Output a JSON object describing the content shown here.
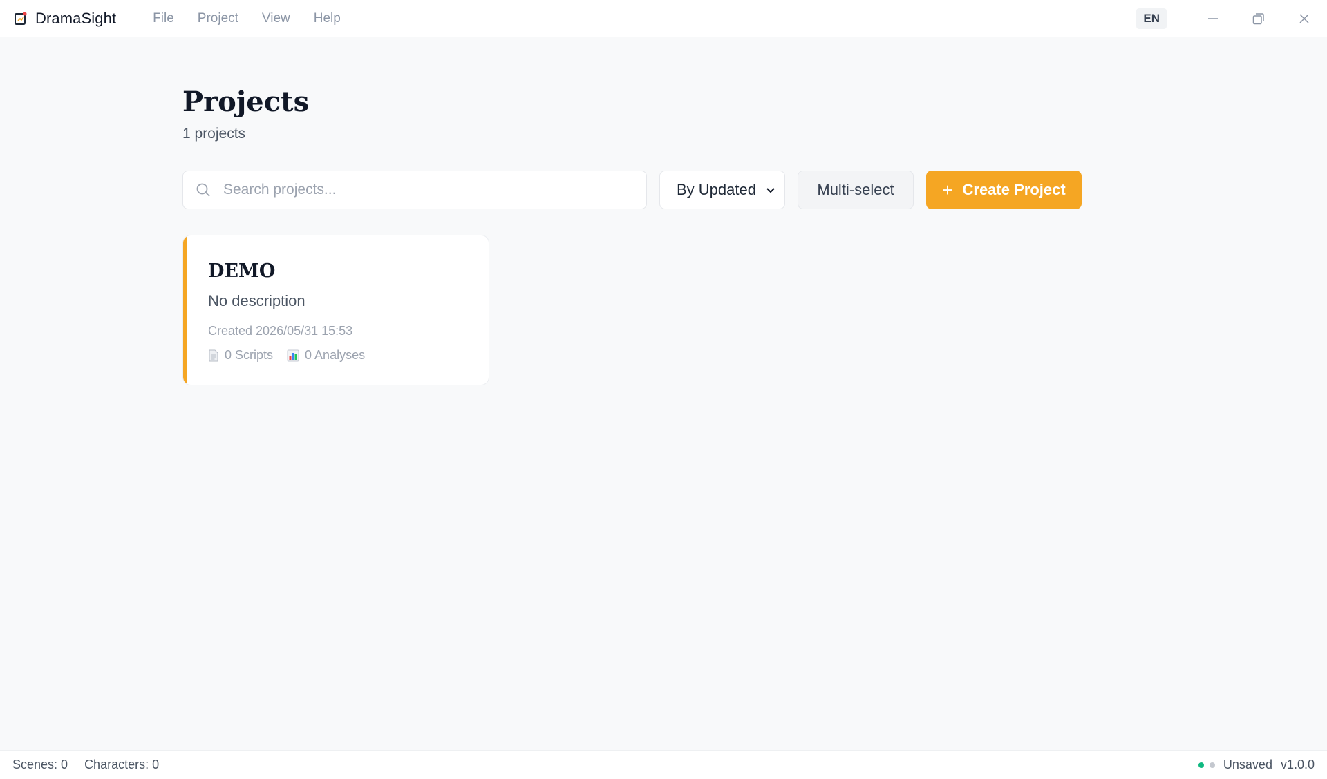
{
  "app": {
    "name": "DramaSight",
    "accent_color": "#f5a623"
  },
  "menu": {
    "items": [
      "File",
      "Project",
      "View",
      "Help"
    ]
  },
  "titlebar": {
    "language": "EN",
    "window_controls": [
      "minimize-icon",
      "restore-icon",
      "close-icon"
    ]
  },
  "page": {
    "title": "Projects",
    "count_text": "1 projects"
  },
  "toolbar": {
    "search_placeholder": "Search projects...",
    "search_value": "",
    "sort_selected": "By Updated",
    "multi_select_label": "Multi-select",
    "create_label": "Create Project"
  },
  "projects": [
    {
      "title": "DEMO",
      "description": "No description",
      "created": "Created 2026/05/31 15:53",
      "scripts": "0 Scripts",
      "analyses": "0 Analyses"
    }
  ],
  "statusbar": {
    "scenes": "Scenes: 0",
    "characters": "Characters: 0",
    "status_dot_1": "#10b981",
    "status_dot_2": "#c4c8cf",
    "save_state": "Unsaved",
    "version": "v1.0.0"
  }
}
